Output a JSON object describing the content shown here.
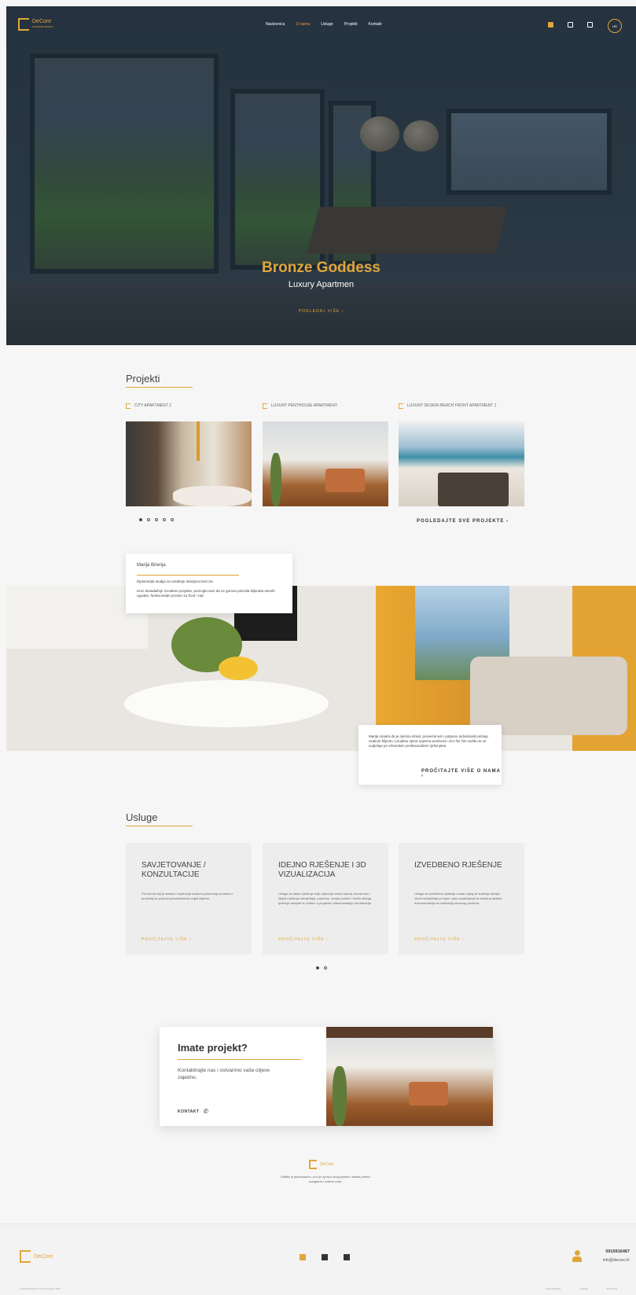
{
  "nav": {
    "brand": "DeCore",
    "brand_tagline": "INTERIOR DESIGN",
    "items": [
      "Naslovnica",
      "O nama",
      "Usluge",
      "Projekti",
      "Kontakt"
    ],
    "active_index": 1,
    "lang": "HR"
  },
  "hero": {
    "title": "Bronze Goddess",
    "subtitle": "Luxury Apartmen",
    "cta": "POGLEDAJ VIŠE  ›"
  },
  "projects": {
    "title": "Projekti",
    "items": [
      {
        "label": "CITY APARTMENT 2"
      },
      {
        "label": "LUXURY PENTHOUSE APARTMENT"
      },
      {
        "label": "LUXURY DESIGN BEACH FRONT APARTMENT 1"
      }
    ],
    "dots": 5,
    "active_dot": 0,
    "cta": "POGLEDAJTE SVE PROJEKTE  ›"
  },
  "about": {
    "name": "Marija Brienja",
    "intro": "Diplomirala studija za uređenje interijera DeCore.",
    "text": "Kroz dosadašnje izvođene projekte, pomogla sam da se gorova polovila klijenata stvorih ugodan, funkcionalan prostor za život i rad.",
    "text2": "Marija smatra da je njezina strast, posvećenost i potpuno individualni pristup svakom klijentu i projektu njena najveća prednost i ono što čini razliku te se sudjeluje po vrhunskim profesionalnim rješenjima.",
    "cta": "PROČITAJTE VIŠE O NAMA  ›"
  },
  "services": {
    "title": "Usluge",
    "items": [
      {
        "title": "SAVJETOVANJE / KONZULTACIJE",
        "text": "Prvi korak koji je sastan i inspiracija svakom poslovanju prostora i prostorija je potpuni personalizirani uvjeti klijenta.",
        "more": "PROČITAJTE VIŠE  ›"
      },
      {
        "title": "IDEJNO RJEŠENJE I 3D VIZUALIZACIJA",
        "text": "Usluga se idejno rješenje koje uključuje izradu nacrta, tlocrta kao i idejnih rješenja namještaja, pripremu, izradu podnih i zidnih obloga, rješenje rasvjete te uvidom u projektnu dokumentaciju vizualizacije.",
        "more": "PROČITAJTE VIŠE  ›"
      },
      {
        "title": "IZVEDBENO RJEŠENJE",
        "text": "Usluga se izvedbeno rješenje unutar kojeg se izrađuju detalji i nacrti namještaja po mjeri, plan postavljanja te ostala projektna dokumentacija za realizaciju stvarnog prostora.",
        "more": "PROČITAJTE VIŠE  ›"
      }
    ],
    "dots": 2,
    "active_dot": 0
  },
  "contact": {
    "title": "Imate projekt?",
    "text": "Kontaktirajte nas i ostvarimo vaše ciljeve zajedno.",
    "cta": "KONTAKT"
  },
  "bottom": {
    "brand": "DeCore",
    "tagline": "Mislite je jednostavno, a to je upravo zbog ljubavi i strasti prema uslugama i našem radu."
  },
  "footer": {
    "brand": "DeCore",
    "phone": "0915916467",
    "email": "info@decore.hr",
    "copyright": "Copyright DeCore Interior Design 2023",
    "links": [
      "Uvjeti uporabe",
      "Kolačići",
      "Privatnost"
    ]
  },
  "colors": {
    "accent": "#e0a63a",
    "hero_overlay": "#2f3d4a",
    "card_bg": "#ededed"
  }
}
